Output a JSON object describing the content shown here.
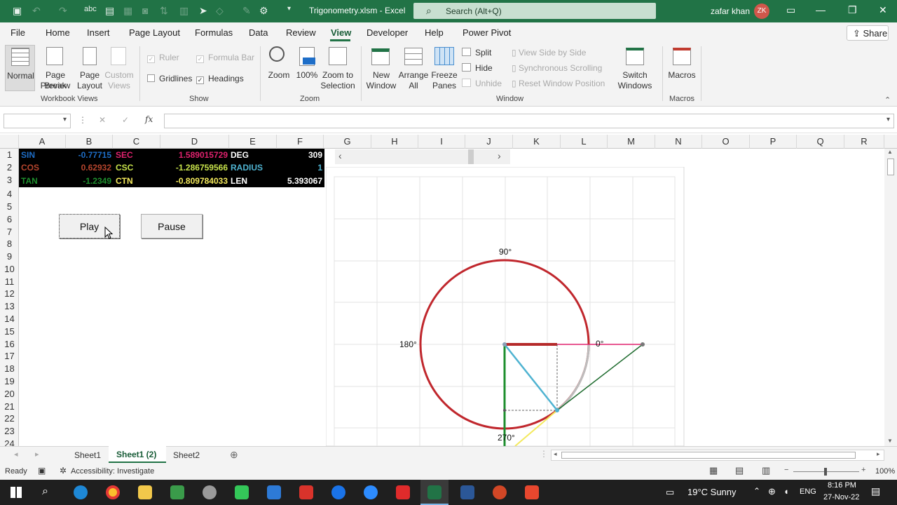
{
  "titlebar": {
    "document": "Trigonometry.xlsm - Excel",
    "search_placeholder": "Search (Alt+Q)",
    "user_name": "zafar khan",
    "user_initials": "ZK"
  },
  "menu": {
    "items": [
      "File",
      "Home",
      "Insert",
      "Page Layout",
      "Formulas",
      "Data",
      "Review",
      "View",
      "Developer",
      "Help",
      "Power Pivot"
    ],
    "active": "View",
    "share": "Share"
  },
  "ribbon": {
    "workbook_views": {
      "normal": "Normal",
      "page_break_1": "Page Break",
      "page_break_2": "Preview",
      "page_layout_1": "Page",
      "page_layout_2": "Layout",
      "custom_1": "Custom",
      "custom_2": "Views",
      "group": "Workbook Views"
    },
    "show": {
      "ruler": "Ruler",
      "formula_bar": "Formula Bar",
      "gridlines": "Gridlines",
      "headings": "Headings",
      "group": "Show"
    },
    "zoom": {
      "zoom": "Zoom",
      "hundred": "100%",
      "sel_1": "Zoom to",
      "sel_2": "Selection",
      "group": "Zoom"
    },
    "window": {
      "new_1": "New",
      "new_2": "Window",
      "arr_1": "Arrange",
      "arr_2": "All",
      "fr_1": "Freeze",
      "fr_2": "Panes",
      "split": "Split",
      "hide": "Hide",
      "unhide": "Unhide",
      "side_by_side": "View Side by Side",
      "sync_scroll": "Synchronous Scrolling",
      "reset_pos": "Reset Window Position",
      "sw_1": "Switch",
      "sw_2": "Windows",
      "group": "Window"
    },
    "macros": {
      "label": "Macros",
      "group": "Macros"
    }
  },
  "formula": {
    "fx": "fx"
  },
  "columns": [
    "A",
    "B",
    "C",
    "D",
    "E",
    "F",
    "G",
    "H",
    "I",
    "J",
    "K",
    "L",
    "M",
    "N",
    "O",
    "P",
    "Q",
    "R"
  ],
  "rows": [
    "1",
    "2",
    "3",
    "4",
    "5",
    "6",
    "7",
    "8",
    "9",
    "10",
    "11",
    "12",
    "13",
    "14",
    "15",
    "16",
    "17",
    "18",
    "19",
    "20",
    "21",
    "22",
    "23",
    "24"
  ],
  "cells": {
    "a1": "SIN",
    "b1": "-0.77715",
    "c1": "SEC",
    "d1": "1.589015729",
    "e1": "DEG",
    "f1": "309",
    "a2": "COS",
    "b2": "0.62932",
    "c2": "CSC",
    "d2": "-1.286759566",
    "e2": "RADIUS",
    "f2": "1",
    "a3": "TAN",
    "b3": "-1.2349",
    "c3": "CTN",
    "d3": "-0.809784033",
    "e3": "LEN",
    "f3": "5.393067"
  },
  "buttons": {
    "play": "Play",
    "pause": "Pause"
  },
  "chart": {
    "deg90": "90°",
    "deg0": "0°",
    "deg180": "180°",
    "deg270": "270°"
  },
  "sheets": {
    "tabs": [
      "Sheet1",
      "Sheet1 (2)",
      "Sheet2"
    ],
    "active": "Sheet1 (2)"
  },
  "status": {
    "ready": "Ready",
    "accessibility": "Accessibility: Investigate",
    "zoom": "100%"
  },
  "taskbar": {
    "weather": "19°C  Sunny",
    "lang": "ENG",
    "time": "8:16 PM",
    "date": "27-Nov-22"
  },
  "colors": {
    "excel_green": "#217346",
    "sin": "#1e6ec8",
    "cos": "#b5452d",
    "tan": "#1e8f2e",
    "sec": "#e0226e",
    "csc": "#c8e34b",
    "ctn": "#f3e95c",
    "deg": "#ffffff",
    "radius": "#4fb3d1"
  }
}
